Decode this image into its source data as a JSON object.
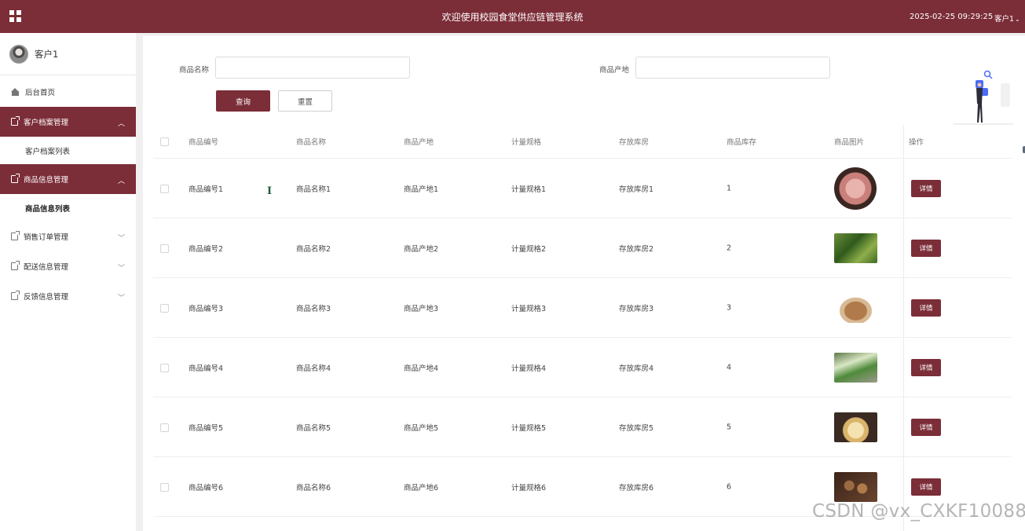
{
  "header": {
    "title": "欢迎使用校园食堂供应链管理系统",
    "datetime": "2025-02-25 09:29:25",
    "user": "客户1"
  },
  "sidebar": {
    "profile_name": "客户1",
    "home": "后台首页",
    "groups": [
      {
        "label": "客户档案管理",
        "sub": "客户档案列表"
      },
      {
        "label": "商品信息管理",
        "sub": "商品信息列表"
      },
      {
        "label": "销售订单管理"
      },
      {
        "label": "配送信息管理"
      },
      {
        "label": "反馈信息管理"
      }
    ]
  },
  "search": {
    "name_label": "商品名称",
    "origin_label": "商品产地",
    "name_value": "",
    "origin_value": "",
    "query_button": "查询",
    "reset_button": "重置"
  },
  "table": {
    "headers": [
      "商品编号",
      "商品名称",
      "商品产地",
      "计量规格",
      "存放库房",
      "商品库存",
      "商品图片",
      "操作"
    ],
    "detail_label": "详情",
    "rows": [
      {
        "code": "商品编号1",
        "name": "商品名称1",
        "origin": "商品产地1",
        "spec": "计量规格1",
        "warehouse": "存放库房1",
        "stock": "1",
        "image": "meat-photo"
      },
      {
        "code": "商品编号2",
        "name": "商品名称2",
        "origin": "商品产地2",
        "spec": "计量规格2",
        "warehouse": "存放库房2",
        "stock": "2",
        "image": "spinach-photo"
      },
      {
        "code": "商品编号3",
        "name": "商品名称3",
        "origin": "商品产地3",
        "spec": "计量规格3",
        "warehouse": "存放库房3",
        "stock": "3",
        "image": "sweet-potato-photo"
      },
      {
        "code": "商品编号4",
        "name": "商品名称4",
        "origin": "商品产地4",
        "spec": "计量规格4",
        "warehouse": "存放库房4",
        "stock": "4",
        "image": "bok-choy-photo"
      },
      {
        "code": "商品编号5",
        "name": "商品名称5",
        "origin": "商品产地5",
        "spec": "计量规格5",
        "warehouse": "存放库房5",
        "stock": "5",
        "image": "dish-photo"
      },
      {
        "code": "商品编号6",
        "name": "商品名称6",
        "origin": "商品产地6",
        "spec": "计量规格6",
        "warehouse": "存放库房6",
        "stock": "6",
        "image": "mushroom-photo"
      }
    ]
  },
  "watermark": "CSDN @vx_CXKF10088",
  "colors": {
    "brand": "#7b2d38"
  }
}
